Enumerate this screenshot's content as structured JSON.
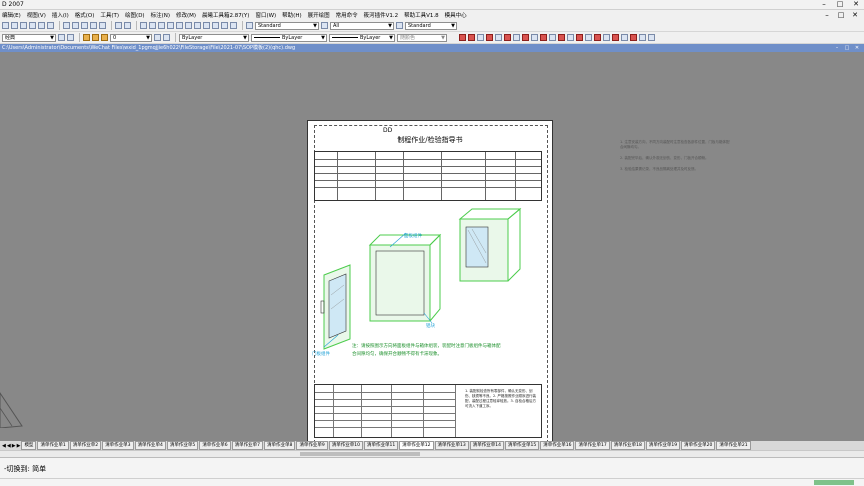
{
  "window": {
    "title": "D 2007",
    "controls": [
      "–",
      "□",
      "✕"
    ]
  },
  "menu": {
    "items": [
      "编辑(E)",
      "视图(V)",
      "插入(I)",
      "格式(O)",
      "工具(T)",
      "绘图(D)",
      "标注(N)",
      "修改(M)",
      "晨曦工具箱2.87(Y)",
      "窗口(W)",
      "帮助(H)",
      "展开绘图",
      "常用命令",
      "筱河插件V1.2",
      "帮助工具V1.8",
      "模具中心"
    ],
    "doc_controls": [
      "–",
      "□",
      "✕"
    ]
  },
  "toolbar1": {
    "textstyle": "Standard",
    "dimstyle": "All",
    "tablestyle": "Standard"
  },
  "toolbar2": {
    "workspace": "经典",
    "layer": "0",
    "color": "ByLayer",
    "linetype": "ByLayer",
    "lineweight": "ByLayer",
    "plotstyle": "随颜色"
  },
  "path": {
    "text": "C:\\Users\\Administrator\\Documents\\WeChat Files\\wxid_1pgmqjjie6h022\\FileStorage\\File\\2021-07\\SOP模板(2)(qhc).dwg",
    "controls": [
      "–",
      "□",
      "✕"
    ]
  },
  "sheet": {
    "doc_no": "DD",
    "title": "制程作业/检验指导书",
    "callouts": [
      "面板组件",
      "门板组件",
      "铝块"
    ],
    "note": "注：请按照图示方向将面板组件与箱体组装，装配时注意门板组件与箱体配合间隙均匀，确保开合顺畅不得有卡滞现象。",
    "footer_note": "1. 装配前检查所有零部件，确认无变形、划伤、缺损等不良。2. 严格按照作业顺序进行装配，装配过程注意轻拿轻放。3. 自检合格后方可流入下道工序。"
  },
  "sidenotes": [
    "1. 注意安装方向，不同方向装配时注意检查各部件位置，门板与箱体配合间隙均匀。",
    "2. 装配完毕后，确认外观无划伤、变形，门板开合顺畅。",
    "3. 检验结果需记录，不良品隔离处理并及时反馈。"
  ],
  "tabs": {
    "nav": [
      "◀",
      "◀",
      "▶",
      "▶"
    ],
    "items": [
      "模型",
      "清单作业单1",
      "清单作业单2",
      "清单作业单3",
      "清单作业单4",
      "清单作业单5",
      "清单作业单6",
      "清单作业单7",
      "清单作业单8",
      "清单作业单9",
      "清单作业单10",
      "清单作业单11",
      "清单作业单12",
      "清单作业单13",
      "清单作业单14",
      "清单作业单15",
      "清单作业单16",
      "清单作业单17",
      "清单作业单18",
      "清单作业单19",
      "清单作业单20",
      "清单作业单21"
    ],
    "active": 12
  },
  "command": {
    "prompt": "-切换到: 简单"
  },
  "colors": {
    "callout": "#1fa0d6",
    "note": "#1b8f2a",
    "part_green": "#4ccc4c",
    "pathbar": "#6f8fc9"
  }
}
